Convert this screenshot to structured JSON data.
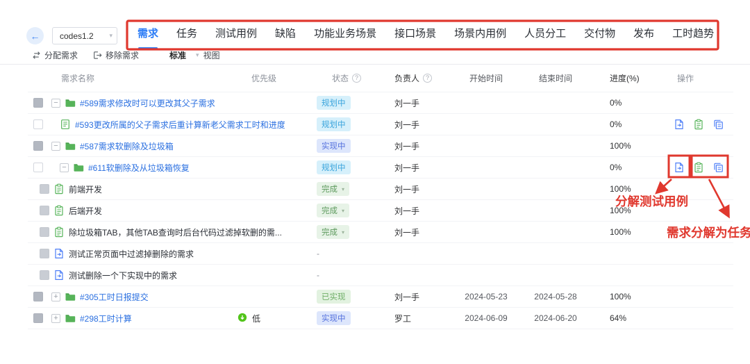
{
  "topbar": {
    "project_select": {
      "value": "codes1.2"
    },
    "tabs": {
      "active": 0,
      "items": [
        {
          "label": "需求"
        },
        {
          "label": "任务"
        },
        {
          "label": "测试用例"
        },
        {
          "label": "缺陷"
        },
        {
          "label": "功能业务场景"
        },
        {
          "label": "接口场景"
        },
        {
          "label": "场景内用例"
        },
        {
          "label": "人员分工"
        },
        {
          "label": "交付物"
        },
        {
          "label": "发布"
        },
        {
          "label": "工时趋势"
        }
      ]
    }
  },
  "toolbar": {
    "assign": "分配需求",
    "remove": "移除需求",
    "view_mode": "标准",
    "view_suffix": "视图"
  },
  "table": {
    "columns": [
      {
        "label": "需求名称"
      },
      {
        "label": "优先级"
      },
      {
        "label": "状态",
        "help": true
      },
      {
        "label": "负责人",
        "help": true
      },
      {
        "label": "开始时间"
      },
      {
        "label": "结束时间"
      },
      {
        "label": "进度(%)"
      },
      {
        "label": "操作"
      }
    ],
    "rows": [
      {
        "indent": 0,
        "checkbox": "filled",
        "expand": "minus",
        "icon": "folder-icon",
        "title": "#589需求修改时可以更改其父子需求",
        "link": true,
        "priority": null,
        "status": {
          "label": "规划中",
          "type": "planning",
          "caret": false
        },
        "assignee": "刘一手",
        "start": "",
        "end": "",
        "progress": "0%",
        "actions": false
      },
      {
        "indent": 1,
        "checkbox": "empty",
        "expand": null,
        "icon": "story-icon",
        "title": "#593更改所属的父子需求后重计算新老父需求工时和进度",
        "link": true,
        "priority": null,
        "status": {
          "label": "规划中",
          "type": "planning",
          "caret": false
        },
        "assignee": "刘一手",
        "start": "",
        "end": "",
        "progress": "0%",
        "actions": true
      },
      {
        "indent": 0,
        "checkbox": "filled",
        "expand": "minus",
        "icon": "folder-icon",
        "title": "#587需求软删除及垃圾箱",
        "link": true,
        "priority": null,
        "status": {
          "label": "实现中",
          "type": "doing",
          "caret": false
        },
        "assignee": "刘一手",
        "start": "",
        "end": "",
        "progress": "100%",
        "actions": false
      },
      {
        "indent": 1,
        "checkbox": "empty",
        "expand": "minus",
        "icon": "folder-icon",
        "title": "#611软删除及从垃圾箱恢复",
        "link": true,
        "priority": null,
        "status": {
          "label": "规划中",
          "type": "planning",
          "caret": false
        },
        "assignee": "刘一手",
        "start": "",
        "end": "",
        "progress": "0%",
        "actions": true
      },
      {
        "indent": 2,
        "checkbox": "disabled",
        "expand": null,
        "icon": "task-icon",
        "title": "前端开发",
        "link": false,
        "priority": null,
        "status": {
          "label": "完成",
          "type": "done",
          "caret": true
        },
        "assignee": "刘一手",
        "start": "",
        "end": "",
        "progress": "100%",
        "actions": false
      },
      {
        "indent": 2,
        "checkbox": "disabled",
        "expand": null,
        "icon": "task-icon",
        "title": "后端开发",
        "link": false,
        "priority": null,
        "status": {
          "label": "完成",
          "type": "done",
          "caret": true
        },
        "assignee": "刘一手",
        "start": "",
        "end": "",
        "progress": "100%",
        "actions": false
      },
      {
        "indent": 2,
        "checkbox": "disabled",
        "expand": null,
        "icon": "task-icon",
        "title": "除垃圾箱TAB，其他TAB查询时后台代码过滤掉软删的需...",
        "link": false,
        "priority": null,
        "status": {
          "label": "完成",
          "type": "done",
          "caret": true
        },
        "assignee": "刘一手",
        "start": "",
        "end": "",
        "progress": "100%",
        "actions": false
      },
      {
        "indent": 2,
        "checkbox": "disabled",
        "expand": null,
        "icon": "testcase-icon",
        "title": "测试正常页面中过滤掉删除的需求",
        "link": false,
        "priority": null,
        "status": {
          "label": "-",
          "type": "none",
          "caret": false
        },
        "assignee": "",
        "start": "",
        "end": "",
        "progress": "",
        "actions": false
      },
      {
        "indent": 2,
        "checkbox": "disabled",
        "expand": null,
        "icon": "testcase-icon",
        "title": "测试删除一个下实现中的需求",
        "link": false,
        "priority": null,
        "status": {
          "label": "-",
          "type": "none",
          "caret": false
        },
        "assignee": "",
        "start": "",
        "end": "",
        "progress": "",
        "actions": false
      },
      {
        "indent": 0,
        "checkbox": "filled",
        "expand": "plus",
        "icon": "folder-icon",
        "title": "#305工时日报提交",
        "link": true,
        "priority": null,
        "status": {
          "label": "已实现",
          "type": "implemented",
          "caret": false
        },
        "assignee": "刘一手",
        "start": "2024-05-23",
        "end": "2024-05-28",
        "progress": "100%",
        "actions": false
      },
      {
        "indent": 0,
        "checkbox": "filled",
        "expand": "plus",
        "icon": "folder-icon",
        "title": "#298工时计算",
        "link": true,
        "priority": {
          "label": "低",
          "icon": "priority-low-icon"
        },
        "status": {
          "label": "实现中",
          "type": "doing",
          "caret": false
        },
        "assignee": "罗工",
        "start": "2024-06-09",
        "end": "2024-06-20",
        "progress": "64%",
        "actions": false
      }
    ]
  },
  "annotations": {
    "label_split_testcase": "分解测试用例",
    "label_split_task": "需求分解为任务"
  },
  "colors": {
    "accent_blue": "#2b7cf6",
    "annotation_red": "#e0382e",
    "link_blue": "#2a6fe0",
    "folder_green": "#56b359",
    "badge_planning_bg": "#d6f0fb",
    "badge_planning_text": "#3aa4dc",
    "badge_doing_bg": "#dde6fc",
    "badge_doing_text": "#5470dd",
    "badge_done_bg": "#e7f3e7",
    "badge_done_text": "#5d9a5d",
    "badge_implemented_bg": "#e2f2e0",
    "badge_implemented_text": "#6fae67"
  }
}
